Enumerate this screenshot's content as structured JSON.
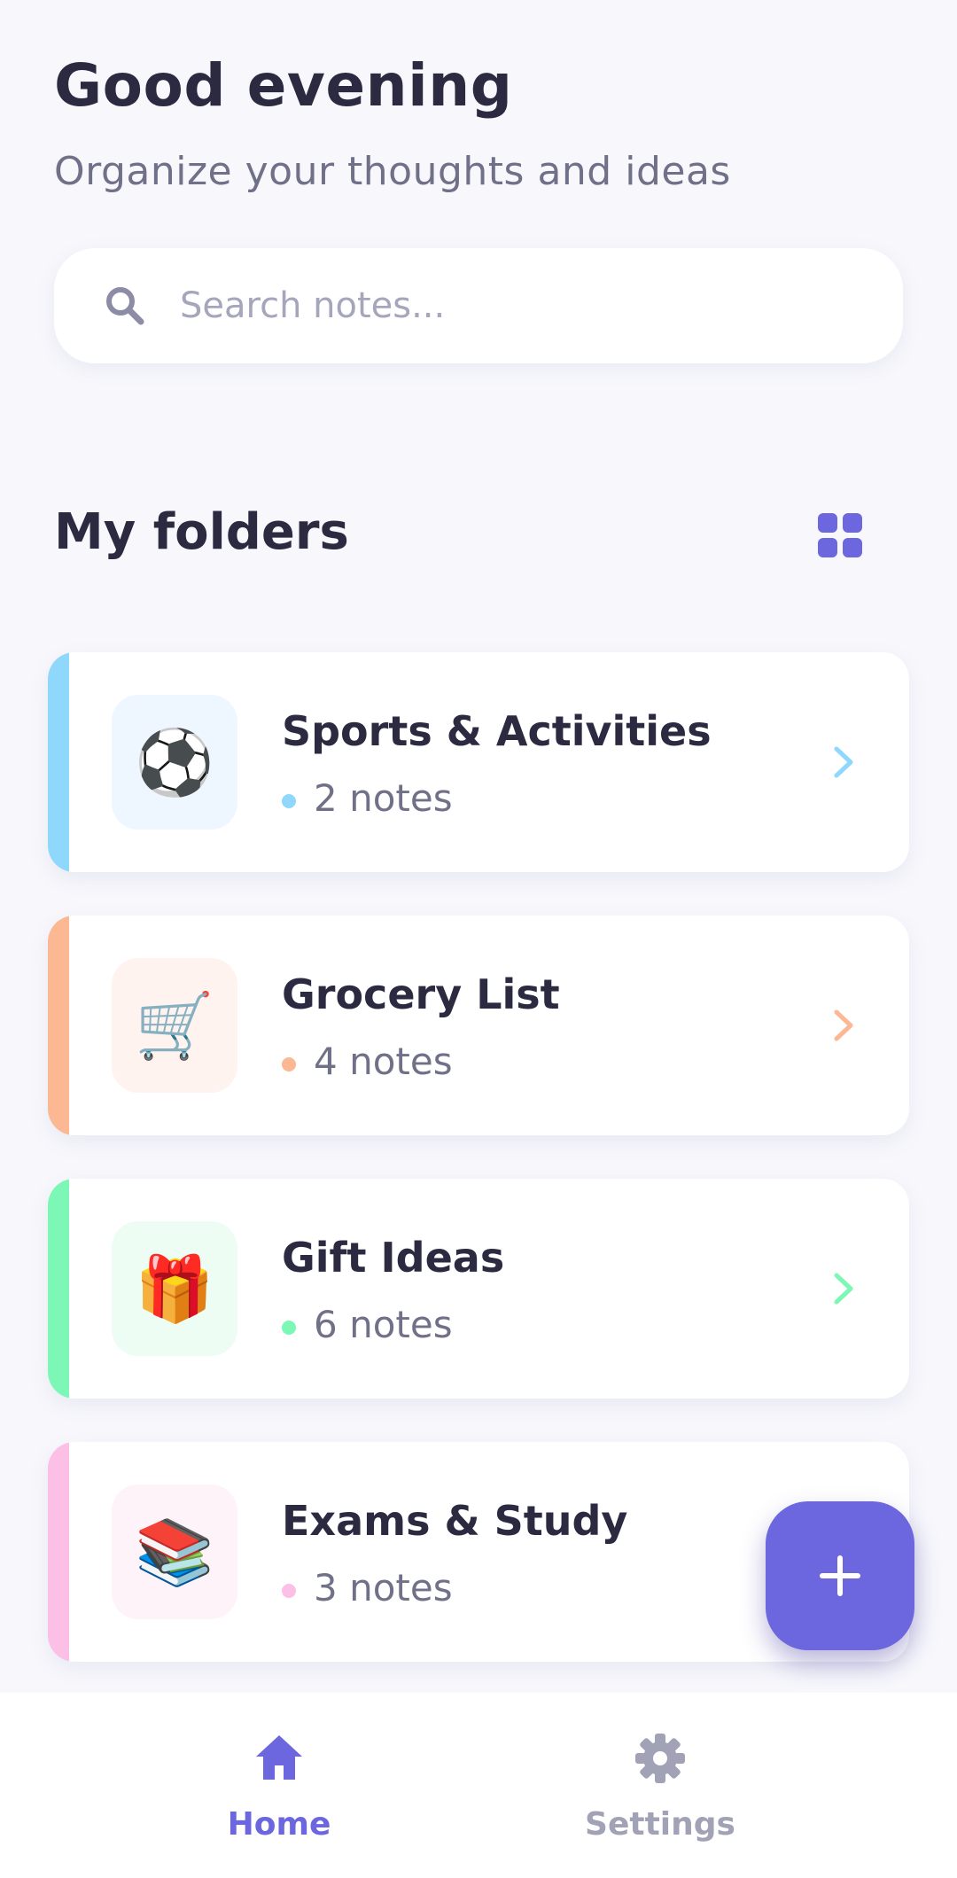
{
  "header": {
    "greeting": "Good evening",
    "subtitle": "Organize your thoughts and ideas"
  },
  "search": {
    "placeholder": "Search notes...",
    "value": "",
    "icon": "search-icon"
  },
  "folders_section": {
    "title": "My folders",
    "view_toggle_icon": "grid-view-icon"
  },
  "folders": [
    {
      "name": "Sports & Activities",
      "count": "2 notes",
      "emoji": "⚽",
      "icon": "soccer-ball-icon",
      "accent": "#8fd8fb",
      "tint": "#eef6ff"
    },
    {
      "name": "Grocery List",
      "count": "4 notes",
      "emoji": "🛒",
      "icon": "shopping-cart-icon",
      "accent": "#fbb893",
      "tint": "#fff3ef"
    },
    {
      "name": "Gift Ideas",
      "count": "6 notes",
      "emoji": "🎁",
      "icon": "gift-icon",
      "accent": "#7cf7b6",
      "tint": "#edfdf4"
    },
    {
      "name": "Exams & Study",
      "count": "3 notes",
      "emoji": "📚",
      "icon": "books-icon",
      "accent": "#fcbfe5",
      "tint": "#fff3fa"
    }
  ],
  "fab": {
    "icon": "plus-icon"
  },
  "bottom_nav": {
    "items": [
      {
        "label": "Home",
        "icon": "home-icon",
        "active": true
      },
      {
        "label": "Settings",
        "icon": "gear-icon",
        "active": false
      }
    ]
  },
  "colors": {
    "accent": "#6c67de",
    "background": "#f7f7fc",
    "text_primary": "#2b2a40",
    "text_secondary": "#707088",
    "nav_inactive": "#a2a2b6"
  }
}
